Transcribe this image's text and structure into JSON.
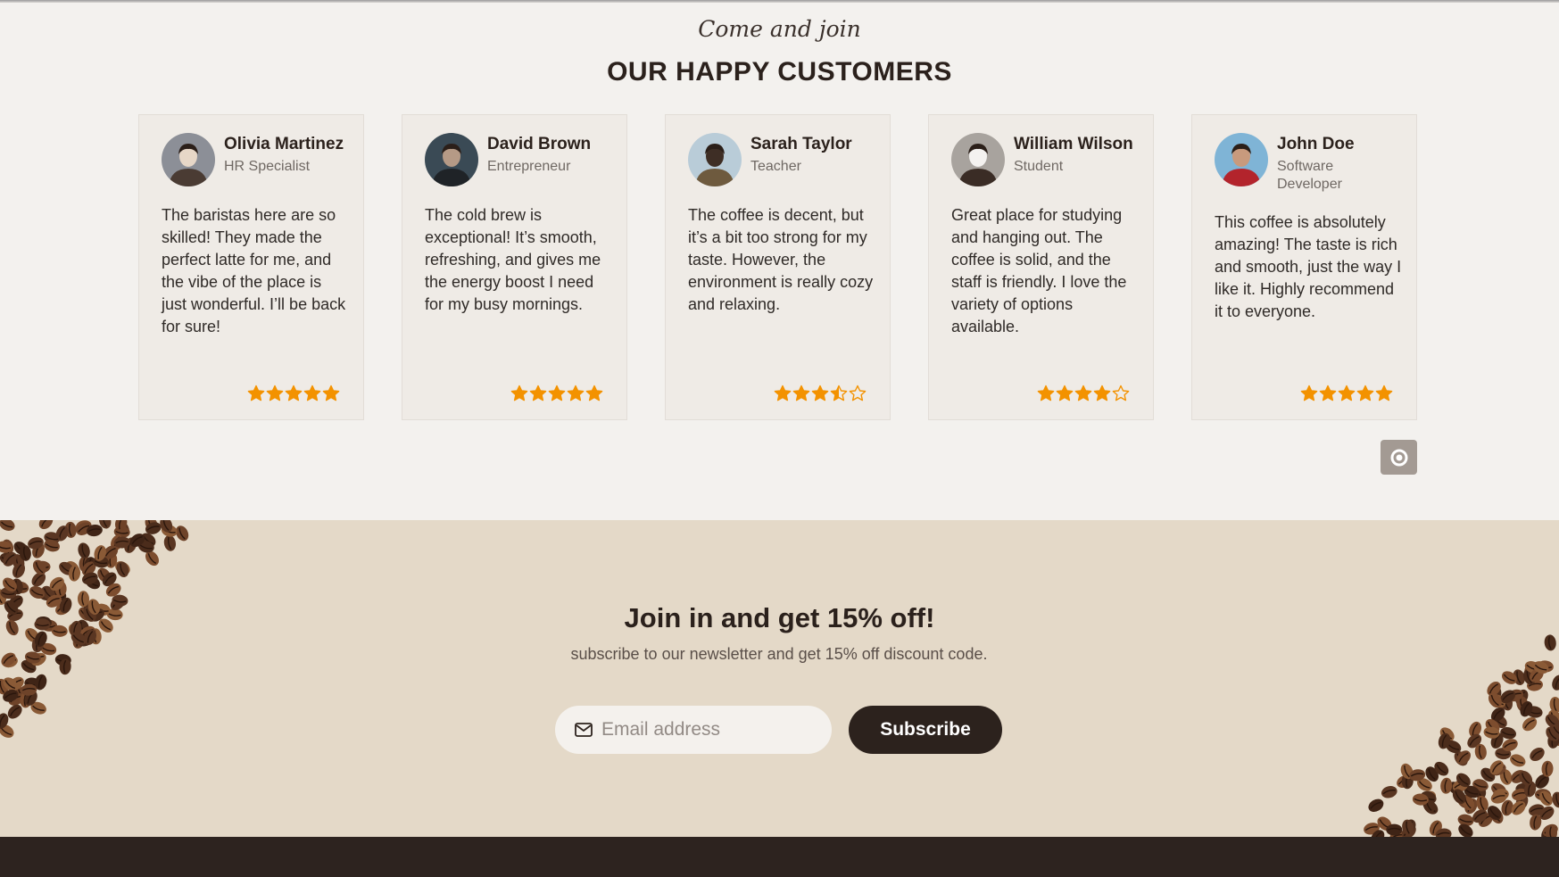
{
  "testimonials": {
    "kicker": "Come and join",
    "heading": "OUR HAPPY CUSTOMERS",
    "cards": [
      {
        "name": "Olivia Martinez",
        "role": "HR Specialist",
        "quote": "The baristas here are so skilled! They made the perfect latte for me, and the vibe of the place is just wonderful. I’ll be back for sure!",
        "rating": 5,
        "avatar_colors": [
          "#8c8f97",
          "#4a3b33",
          "#e7d7c7"
        ]
      },
      {
        "name": "David Brown",
        "role": "Entrepreneur",
        "quote": "The cold brew is exceptional! It’s smooth, refreshing, and gives me the energy boost I need for my busy mornings.",
        "rating": 5,
        "avatar_colors": [
          "#3a4a55",
          "#1f2327",
          "#b59a86"
        ]
      },
      {
        "name": "Sarah Taylor",
        "role": "Teacher",
        "quote": "The coffee is decent, but it’s a bit too strong for my taste. However, the environment is really cozy and relaxing.",
        "rating": 3.5,
        "avatar_colors": [
          "#b9ccd8",
          "#6e5a3e",
          "#3e2e25"
        ]
      },
      {
        "name": "William Wilson",
        "role": "Student",
        "quote": "Great place for studying and hanging out. The coffee is solid, and the staff is friendly. I love the variety of options available.",
        "rating": 4,
        "avatar_colors": [
          "#a8a39e",
          "#3a2c25",
          "#f4f2f0"
        ]
      },
      {
        "name": "John Doe",
        "role": "Software Developer",
        "quote": "This coffee is absolutely amazing! The taste is rich and smooth, just the way I like it. Highly recommend it to everyone.",
        "rating": 5,
        "avatar_colors": [
          "#7fb4d6",
          "#b3242c",
          "#c89a7d"
        ]
      }
    ],
    "star_color": "#f39200",
    "pager_icon": "circle-dot-icon"
  },
  "newsletter": {
    "title": "Join in and get 15% off!",
    "subtitle": "subscribe to our newsletter and get 15% off discount code.",
    "email_placeholder": "Email address",
    "email_icon": "mail-icon",
    "subscribe_label": "Subscribe",
    "background": "#e4d9c8",
    "button_color": "#2c221d"
  },
  "footer": {
    "background": "#2d231f"
  }
}
